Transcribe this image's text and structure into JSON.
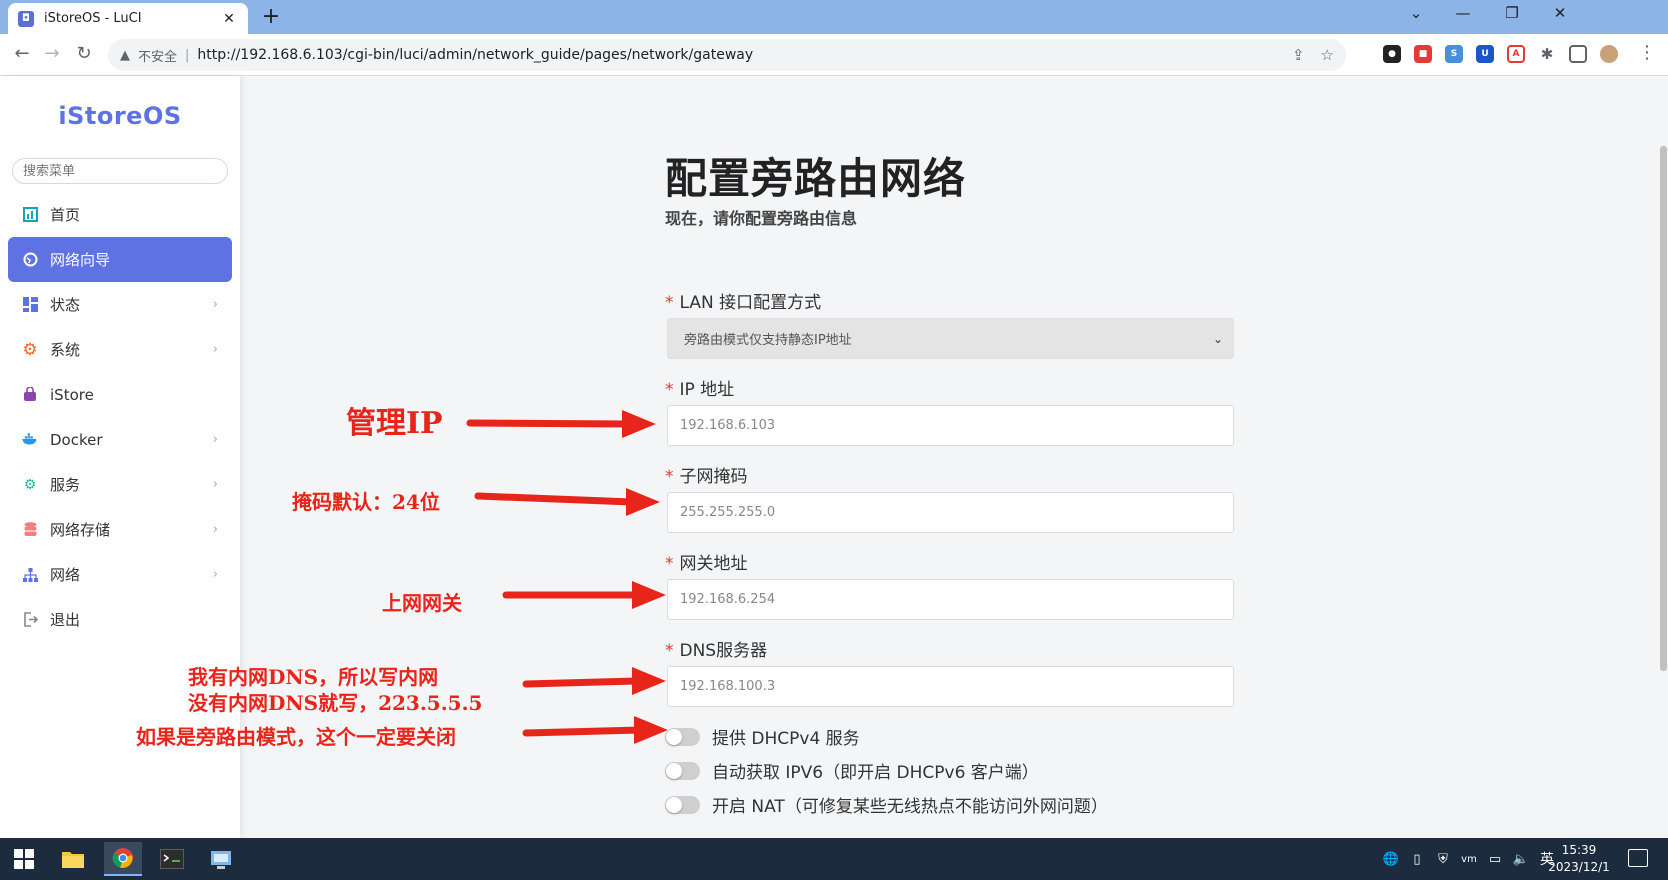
{
  "browser": {
    "tab_title": "iStoreOS - LuCI",
    "tab_close": "✕",
    "new_tab": "+",
    "security_label": "不安全",
    "url": "http://192.168.6.103/cgi-bin/luci/admin/network_guide/pages/network/gateway"
  },
  "sidebar": {
    "logo": "iStoreOS",
    "search_placeholder": "搜索菜单",
    "items": [
      {
        "label": "首页"
      },
      {
        "label": "网络向导"
      },
      {
        "label": "状态"
      },
      {
        "label": "系统"
      },
      {
        "label": "iStore"
      },
      {
        "label": "Docker"
      },
      {
        "label": "服务"
      },
      {
        "label": "网络存储"
      },
      {
        "label": "网络"
      },
      {
        "label": "退出"
      }
    ]
  },
  "main": {
    "title": "配置旁路由网络",
    "subtitle": "现在，请你配置旁路由信息",
    "fields": {
      "lan_mode": {
        "label": "LAN 接口配置方式",
        "value": "旁路由模式仅支持静态IP地址"
      },
      "ip": {
        "label": "IP 地址",
        "value": "192.168.6.103"
      },
      "netmask": {
        "label": "子网掩码",
        "value": "255.255.255.0"
      },
      "gateway": {
        "label": "网关地址",
        "value": "192.168.6.254"
      },
      "dns": {
        "label": "DNS服务器",
        "value": "192.168.100.3"
      }
    },
    "required_mark": "*",
    "toggles": [
      {
        "label": "提供 DHCPv4 服务",
        "on": false
      },
      {
        "label": "自动获取 IPV6（即开启 DHCPv6 客户端）",
        "on": false
      },
      {
        "label": "开启 NAT（可修复某些无线热点不能访问外网问题）",
        "on": false
      }
    ]
  },
  "annotations": {
    "mgmt_ip": "管理IP",
    "mask": "掩码默认：24位",
    "gateway": "上网网关",
    "dns_line1": "我有内网DNS，所以写内网",
    "dns_line2": "没有内网DNS就写，223.5.5.5",
    "dhcp": "如果是旁路由模式，这个一定要关闭"
  },
  "taskbar": {
    "ime": "英",
    "time": "15:39",
    "date": "2023/12/1"
  },
  "colors": {
    "accent": "#5e72e4",
    "annotation_red": "#e8251b",
    "taskbar": "#1c2b3e",
    "tabbar": "#8db4e6"
  }
}
